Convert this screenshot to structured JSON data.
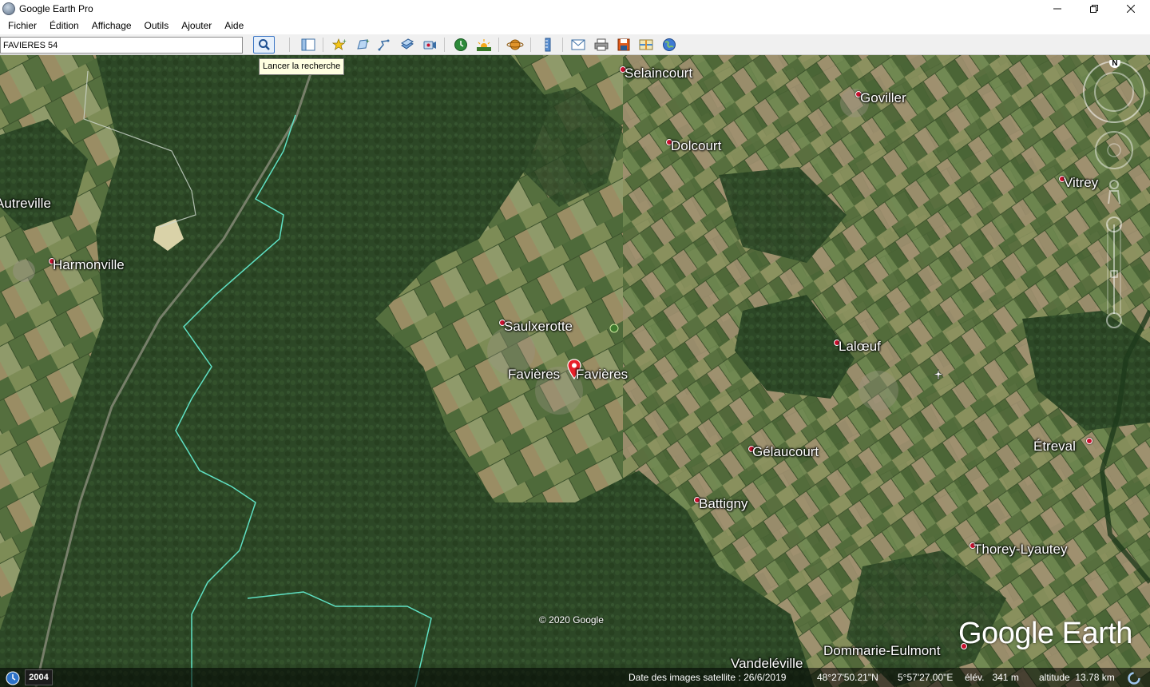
{
  "window": {
    "title": "Google Earth Pro"
  },
  "menu": [
    {
      "label": "Fichier"
    },
    {
      "label": "Édition"
    },
    {
      "label": "Affichage"
    },
    {
      "label": "Outils"
    },
    {
      "label": "Ajouter"
    },
    {
      "label": "Aide"
    }
  ],
  "search": {
    "value": "FAVIERES 54",
    "tooltip": "Lancer la recherche"
  },
  "toolbar_icons": [
    "search-icon",
    "sidebar-toggle-icon",
    "placemark-icon",
    "polygon-icon",
    "path-icon",
    "image-overlay-icon",
    "record-tour-icon",
    "historical-imagery-icon",
    "sunlight-icon",
    "planets-icon",
    "ruler-icon",
    "email-icon",
    "print-icon",
    "save-image-icon",
    "view-in-maps-icon",
    "earth-icon"
  ],
  "map": {
    "places": [
      {
        "name": "Selaincourt"
      },
      {
        "name": "Goviller"
      },
      {
        "name": "Dolcourt"
      },
      {
        "name": "Vitrey"
      },
      {
        "name": "Autreville"
      },
      {
        "name": "Harmonville"
      },
      {
        "name": "Saulxerotte"
      },
      {
        "name": "Favières"
      },
      {
        "name": "Favières"
      },
      {
        "name": "Lalœuf"
      },
      {
        "name": "Gélaucourt"
      },
      {
        "name": "Étreval"
      },
      {
        "name": "Battigny"
      },
      {
        "name": "Thorey-Lyautey"
      },
      {
        "name": "Dommarie-Eulmont"
      },
      {
        "name": "Vandeléville"
      }
    ],
    "copyright": "© 2020 Google",
    "logo": "Google Earth",
    "compass_label": "N"
  },
  "status": {
    "history_year": "2004",
    "imagery_date": "Date des images satellite : 26/6/2019",
    "latitude": "48°27'50.21\"N",
    "longitude": "5°57'27.00\"E",
    "elevation": "élév.   341 m",
    "altitude": "altitude  13.78 km"
  }
}
